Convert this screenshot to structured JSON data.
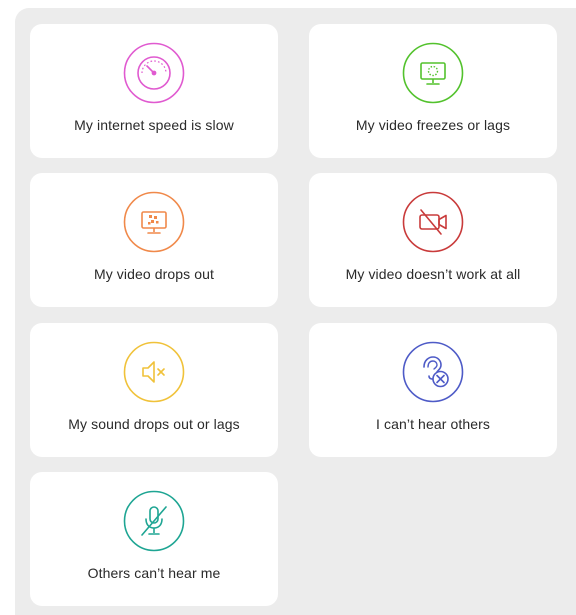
{
  "issues": [
    {
      "label": "My internet speed is slow",
      "icon": "speedometer-icon",
      "color": "#e05ad0"
    },
    {
      "label": "My video freezes or lags",
      "icon": "monitor-loading-icon",
      "color": "#53c22d"
    },
    {
      "label": "My video drops out",
      "icon": "monitor-glitch-icon",
      "color": "#f0894a"
    },
    {
      "label": "My video doesn’t work at all",
      "icon": "video-off-icon",
      "color": "#c93b3b"
    },
    {
      "label": "My sound drops out or lags",
      "icon": "speaker-mute-icon",
      "color": "#f0c23a"
    },
    {
      "label": "I can’t hear others",
      "icon": "ear-off-icon",
      "color": "#4e5bc7"
    },
    {
      "label": "Others can’t hear me",
      "icon": "mic-off-icon",
      "color": "#1ea593"
    }
  ]
}
